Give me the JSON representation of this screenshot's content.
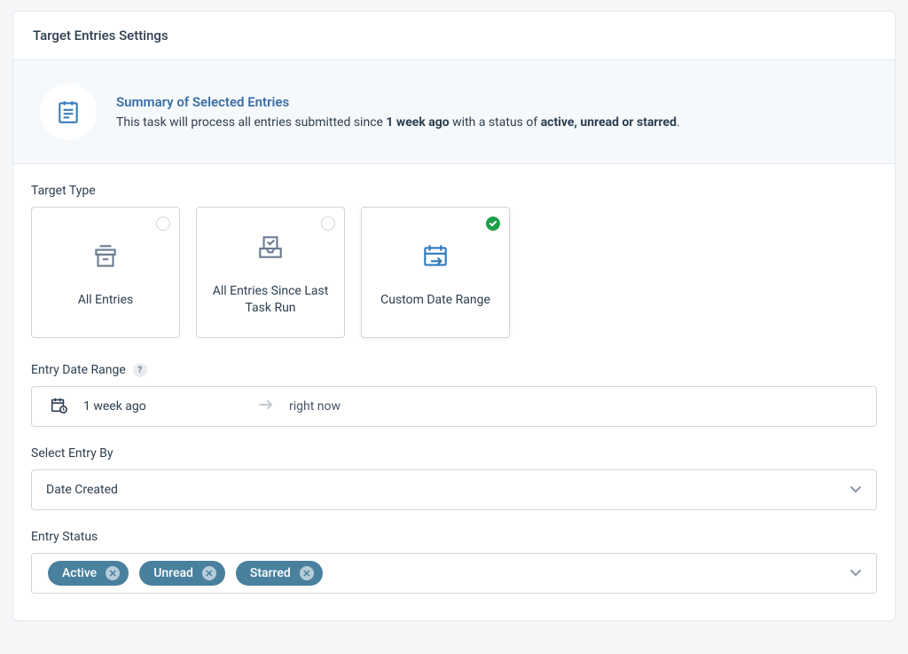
{
  "panel": {
    "title": "Target Entries Settings"
  },
  "summary": {
    "title": "Summary of Selected Entries",
    "prefix": "This task will process all entries submitted since ",
    "time_bold": "1 week ago",
    "middle": " with a status of ",
    "status_bold": "active, unread or starred",
    "suffix": "."
  },
  "target_type": {
    "label": "Target Type",
    "options": [
      {
        "label": "All Entries",
        "selected": false
      },
      {
        "label": "All Entries Since Last Task Run",
        "selected": false
      },
      {
        "label": "Custom Date Range",
        "selected": true
      }
    ]
  },
  "date_range": {
    "label": "Entry Date Range",
    "from": "1 week ago",
    "to": "right now"
  },
  "select_entry_by": {
    "label": "Select Entry By",
    "value": "Date Created"
  },
  "entry_status": {
    "label": "Entry Status",
    "chips": [
      {
        "label": "Active"
      },
      {
        "label": "Unread"
      },
      {
        "label": "Starred"
      }
    ]
  },
  "icons": {
    "help": "?"
  }
}
